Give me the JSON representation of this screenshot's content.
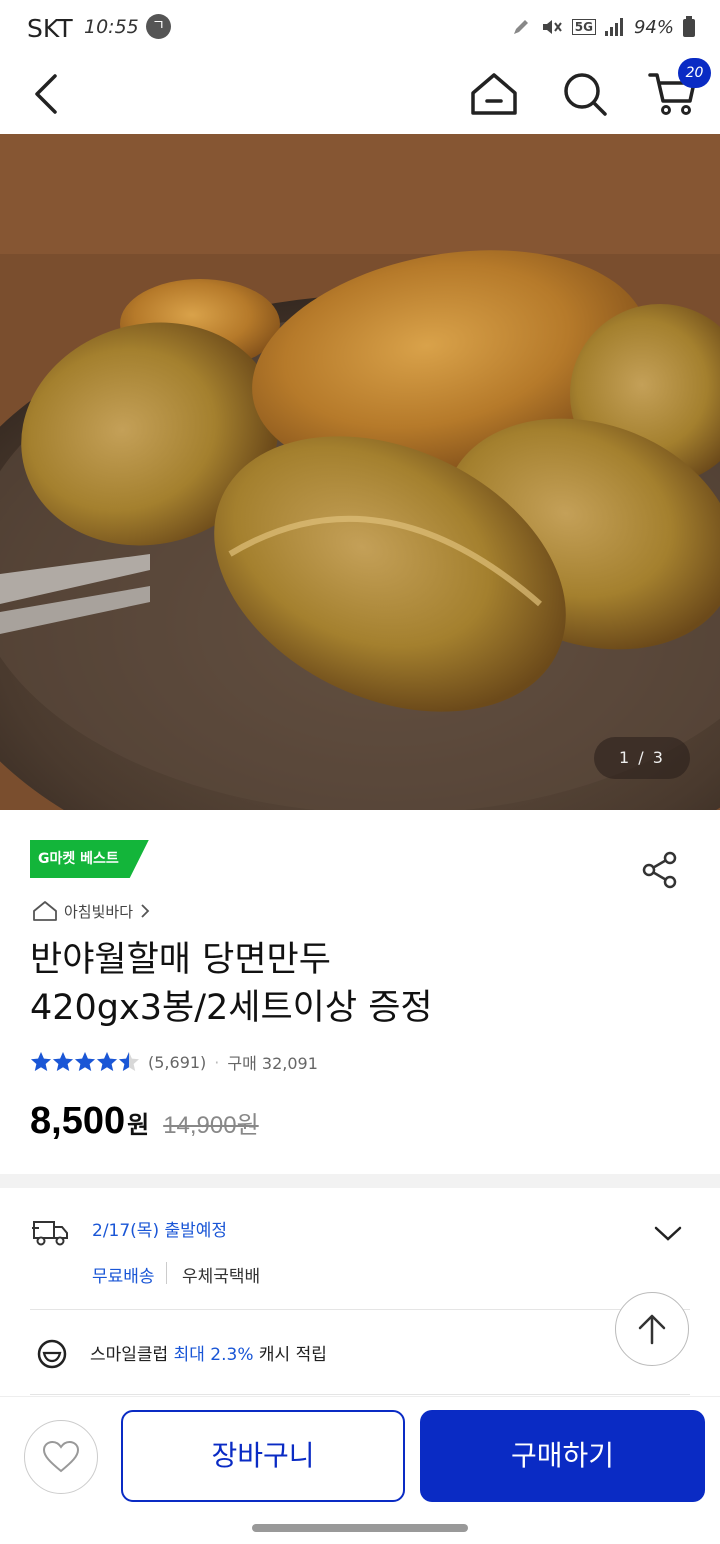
{
  "status_bar": {
    "carrier": "SKT",
    "time": "10:55",
    "notification": "ㄱ",
    "network": "5G",
    "battery": "94%"
  },
  "nav": {
    "back_icon": "chevron-left-icon",
    "home_icon": "home-icon",
    "search_icon": "search-icon",
    "cart_icon": "cart-icon",
    "cart_count": "20"
  },
  "hero": {
    "page_indicator": "1 / 3"
  },
  "product": {
    "badge": "G마켓 베스트",
    "seller": "아침빛바다",
    "title_line1": "반야월할매 당면만두",
    "title_line2": "420gx3봉/2세트이상 증정",
    "rating_value": 4.5,
    "review_count": "(5,691)",
    "purchase_count": "구매 32,091",
    "price": "8,500",
    "currency": "원",
    "original_price": "14,900원"
  },
  "delivery": {
    "ship_date": "2/17(목) 출발예정",
    "shipping_fee": "무료배송",
    "carrier": "우체국택배"
  },
  "smile_club": {
    "prefix": "스마일클럽",
    "highlight": "최대 2.3%",
    "suffix": "캐시 적립"
  },
  "actions": {
    "wishlist_icon": "heart-icon",
    "add_to_cart": "장바구니",
    "buy_now": "구매하기"
  },
  "colors": {
    "primary": "#0a2bc4",
    "link": "#1a56d6",
    "badge": "#13b53a",
    "star": "#1a56d6"
  }
}
